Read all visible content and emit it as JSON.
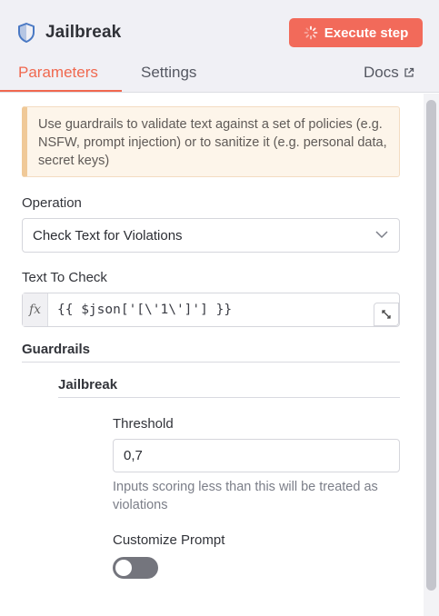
{
  "header": {
    "title": "Jailbreak",
    "title_icon": "shield-icon",
    "execute_label": "Execute step",
    "execute_color": "#f26a5a"
  },
  "tabs": [
    {
      "label": "Parameters",
      "active": true
    },
    {
      "label": "Settings",
      "active": false
    }
  ],
  "docs_label": "Docs",
  "notice": "Use guardrails to validate text against a set of policies (e.g. NSFW, prompt injection) or to sanitize it (e.g. personal data, secret keys)",
  "operation": {
    "label": "Operation",
    "value": "Check Text for Violations"
  },
  "text_to_check": {
    "label": "Text To Check",
    "fx": "fx",
    "value": "{{ $json['[\\'1\\']'] }}"
  },
  "guardrails": {
    "title": "Guardrails",
    "jailbreak": {
      "title": "Jailbreak",
      "threshold_label": "Threshold",
      "threshold_value": "0,7",
      "threshold_hint": "Inputs scoring less than this will be treated as violations",
      "customize_label": "Customize Prompt",
      "customize_on": false
    }
  },
  "colors": {
    "accent": "#f0684f",
    "notice_bg": "#fdf5ea",
    "notice_border": "#f0c998"
  }
}
